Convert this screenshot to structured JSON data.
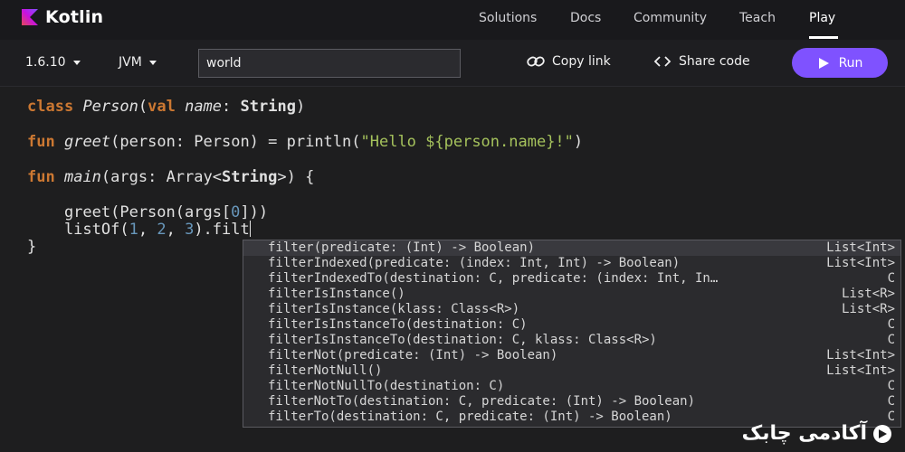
{
  "nav": {
    "logo_text": "Kotlin",
    "items": [
      "Solutions",
      "Docs",
      "Community",
      "Teach",
      "Play"
    ]
  },
  "toolbar": {
    "version": "1.6.10",
    "target": "JVM",
    "program_args": "world",
    "copy_link": "Copy link",
    "share_code": "Share code",
    "run": "Run"
  },
  "code": {
    "l1": {
      "a": "class",
      "b": " ",
      "c": "Person",
      "d": "(",
      "e": "val",
      "f": " ",
      "g": "name",
      "h": ": ",
      "i": "String",
      "j": ")"
    },
    "l2": {
      "a": "fun",
      "b": " ",
      "c": "greet",
      "d": "(person: Person) = println(",
      "e": "\"Hello ${person.name}!\"",
      "f": ")"
    },
    "l3": {
      "a": "fun",
      "b": " ",
      "c": "main",
      "d": "(args: Array<",
      "e": "String",
      "f": ">) {"
    },
    "l4": {
      "a": "    greet(Person(args[",
      "b": "0",
      "c": "]))"
    },
    "l5": {
      "a": "    listOf(",
      "b": "1",
      "c": ", ",
      "d": "2",
      "e": ", ",
      "f": "3",
      "g": ").filt"
    },
    "l6": "}"
  },
  "completions": [
    {
      "sig": "filter(predicate: (Int) -> Boolean)",
      "type": "List<Int>"
    },
    {
      "sig": "filterIndexed(predicate: (index: Int, Int) -> Boolean)",
      "type": "List<Int>"
    },
    {
      "sig": "filterIndexedTo(destination: C, predicate: (index: Int, In…",
      "type": "C"
    },
    {
      "sig": "filterIsInstance()",
      "type": "List<R>"
    },
    {
      "sig": "filterIsInstance(klass: Class<R>)",
      "type": "List<R>"
    },
    {
      "sig": "filterIsInstanceTo(destination: C)",
      "type": "C"
    },
    {
      "sig": "filterIsInstanceTo(destination: C, klass: Class<R>)",
      "type": "C"
    },
    {
      "sig": "filterNot(predicate: (Int) -> Boolean)",
      "type": "List<Int>"
    },
    {
      "sig": "filterNotNull()",
      "type": "List<Int>"
    },
    {
      "sig": "filterNotNullTo(destination: C)",
      "type": "C"
    },
    {
      "sig": "filterNotTo(destination: C, predicate: (Int) -> Boolean)",
      "type": "C"
    },
    {
      "sig": "filterTo(destination: C, predicate: (Int) -> Boolean)",
      "type": "C"
    }
  ],
  "watermark": "آکادمی چابک",
  "colors": {
    "accent": "#7f52ff",
    "keyword": "#cc7832",
    "string": "#a5c25c",
    "number": "#6897bb"
  }
}
